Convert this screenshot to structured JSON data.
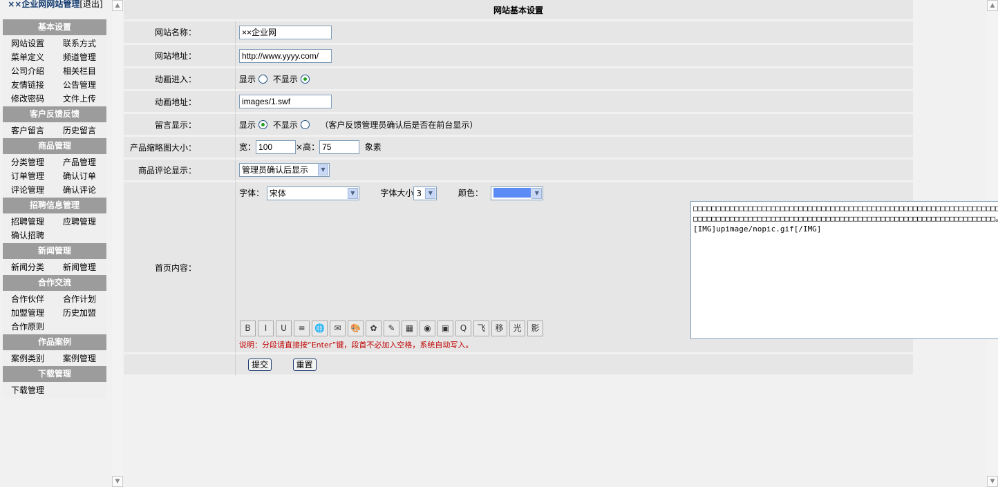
{
  "sidebar": {
    "title": "××企业网网站管理",
    "logout": "[退出]",
    "groups": [
      {
        "title": "基本设置",
        "items": [
          "网站设置",
          "联系方式",
          "菜单定义",
          "频道管理",
          "公司介绍",
          "相关栏目",
          "友情链接",
          "公告管理",
          "修改密码",
          "文件上传"
        ]
      },
      {
        "title": "客户反馈反馈",
        "items": [
          "客户留言",
          "历史留言"
        ]
      },
      {
        "title": "商品管理",
        "items": [
          "分类管理",
          "产品管理",
          "订单管理",
          "确认订单",
          "评论管理",
          "确认评论"
        ]
      },
      {
        "title": "招聘信息管理",
        "items": [
          "招聘管理",
          "应聘管理",
          "确认招聘"
        ]
      },
      {
        "title": "新闻管理",
        "items": [
          "新闻分类",
          "新闻管理"
        ]
      },
      {
        "title": "合作交流",
        "items": [
          "合作伙伴",
          "合作计划",
          "加盟管理",
          "历史加盟",
          "合作原则"
        ]
      },
      {
        "title": "作品案例",
        "items": [
          "案例类别",
          "案例管理"
        ]
      },
      {
        "title": "下载管理",
        "items": [
          "下载管理"
        ]
      }
    ]
  },
  "form": {
    "header": "网站基本设置",
    "site_name_label": "网站名称：",
    "site_name_value": "××企业网",
    "site_url_label": "网站地址：",
    "site_url_value": "http://www.yyyy.com/",
    "anim_enter_label": "动画进入：",
    "anim_show": "显示",
    "anim_hide": "不显示",
    "anim_url_label": "动画地址：",
    "anim_url_value": "images/1.swf",
    "msg_show_label": "留言显示：",
    "msg_show": "显示",
    "msg_hide": "不显示",
    "msg_note": "（客户反馈管理员确认后是否在前台显示）",
    "thumb_label": "产品缩略图大小：",
    "width_label": "宽：",
    "width_value": "100",
    "times": "×高：",
    "height_value": "75",
    "px_unit": "象素",
    "comment_label": "商品评论显示：",
    "comment_value": "管理员确认后显示",
    "home_label": "首页内容：",
    "font_label": "字体：",
    "font_value": "宋体",
    "size_label": "字体大小",
    "size_value": "3",
    "color_label": "颜色：",
    "color_value": "#5b8bf4",
    "editor_text": "□□□□□□□□□□□□□□□□□□□□□□□□□□□□□□□□□□□□□□□□□□□□□□□□□□□□□□□□□□□□□□□□□□□□□□□□□□□□□□□□□□□□□□□□□□□□□□□□□□□□□□□□□□□□□□□□□□□□□□□□□□□□□□□□□□□□□□。[IMG]upimage/nopic.gif[/IMG]",
    "toolbar": [
      "B",
      "I",
      "U",
      "≡",
      "🌐",
      "✉",
      "🎨",
      "✿",
      "✎",
      "▦",
      "◉",
      "▣",
      "Q",
      "飞",
      "移",
      "光",
      "影"
    ],
    "editor_note": "说明：分段请直接按“Enter”键，段首不必加入空格，系统自动写入。",
    "submit_label": "提交",
    "reset_label": "重置"
  }
}
